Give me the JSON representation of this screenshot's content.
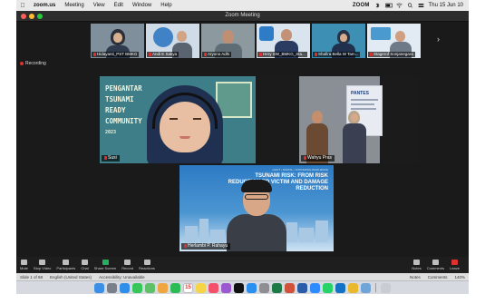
{
  "menubar": {
    "app": "zoom.us",
    "menus": [
      "Meeting",
      "View",
      "Edit",
      "Window",
      "Help"
    ],
    "brand_tag": "ZOOM",
    "datetime": "Thu 15 Jun 10"
  },
  "window": {
    "title": "Zoom Meeting"
  },
  "participants": [
    {
      "name": "Hidayanti_PST BMKG"
    },
    {
      "name": "Andi E Sakya"
    },
    {
      "name": "Aryono Adhi"
    },
    {
      "name": "Hery SW_BMKG_Sta..."
    },
    {
      "name": "Shafira Bella W Tam..."
    },
    {
      "name": "Stagerof Sonjanegara"
    }
  ],
  "recording_label": "Recording",
  "tiles": {
    "susi": {
      "name": "Susi",
      "bg_text": [
        "PENGANTAR",
        "TSUNAMI",
        "READY",
        "COMMUNITY",
        "2023"
      ]
    },
    "wahyu": {
      "name": "Wahyu Pras",
      "banner_text": "PANTES"
    },
    "herlambang": {
      "name": "Herlambi P. Rahayu",
      "slide_small": "GOUT • DIGITAL • FOSTERING RESILIENCE",
      "slide_title": "TSUNAMI RISK: FROM RISK REDUCTION TO VICTIM AND DAMAGE REDUCTION"
    }
  },
  "controls": {
    "items": [
      "Mute",
      "Stop Video",
      "Participants",
      "Chat",
      "Share Screen",
      "Record",
      "Reactions"
    ],
    "right_items": [
      "Notes",
      "Comments",
      "Leave"
    ]
  },
  "statusbar": {
    "slide": "Slide 1 of 68",
    "language": "English (United States)",
    "accessibility": "Accessibility: Unavailable",
    "notes": "Notes",
    "comments": "Comments",
    "zoom": "140%"
  },
  "dock": {
    "calendar_day": "15",
    "apps": [
      {
        "name": "Finder",
        "color": "#3b8fe6"
      },
      {
        "name": "Launchpad",
        "color": "#7a7f8a"
      },
      {
        "name": "Safari",
        "color": "#2f8ee8"
      },
      {
        "name": "Messages",
        "color": "#35c759"
      },
      {
        "name": "Maps",
        "color": "#5fbf6a"
      },
      {
        "name": "Photos",
        "color": "#f0a640"
      },
      {
        "name": "FaceTime",
        "color": "#2dbb55"
      },
      {
        "name": "Calendar",
        "color": "#ffffff"
      },
      {
        "name": "Notes",
        "color": "#f5d547"
      },
      {
        "name": "Music",
        "color": "#f2506b"
      },
      {
        "name": "Podcasts",
        "color": "#9b59d0"
      },
      {
        "name": "TV",
        "color": "#111111"
      },
      {
        "name": "App Store",
        "color": "#2b8ff0"
      },
      {
        "name": "System Settings",
        "color": "#8e8e93"
      },
      {
        "name": "Excel",
        "color": "#1d7a45"
      },
      {
        "name": "PowerPoint",
        "color": "#d0523a"
      },
      {
        "name": "Word",
        "color": "#2a5ca8"
      },
      {
        "name": "Zoom",
        "color": "#2d8cff"
      },
      {
        "name": "WhatsApp",
        "color": "#25d366"
      },
      {
        "name": "Outlook",
        "color": "#1372c4"
      },
      {
        "name": "Chrome",
        "color": "#e9b82c"
      },
      {
        "name": "Preview",
        "color": "#6fa4d8"
      },
      {
        "name": "Trash",
        "color": "#c9ccd2"
      }
    ]
  }
}
